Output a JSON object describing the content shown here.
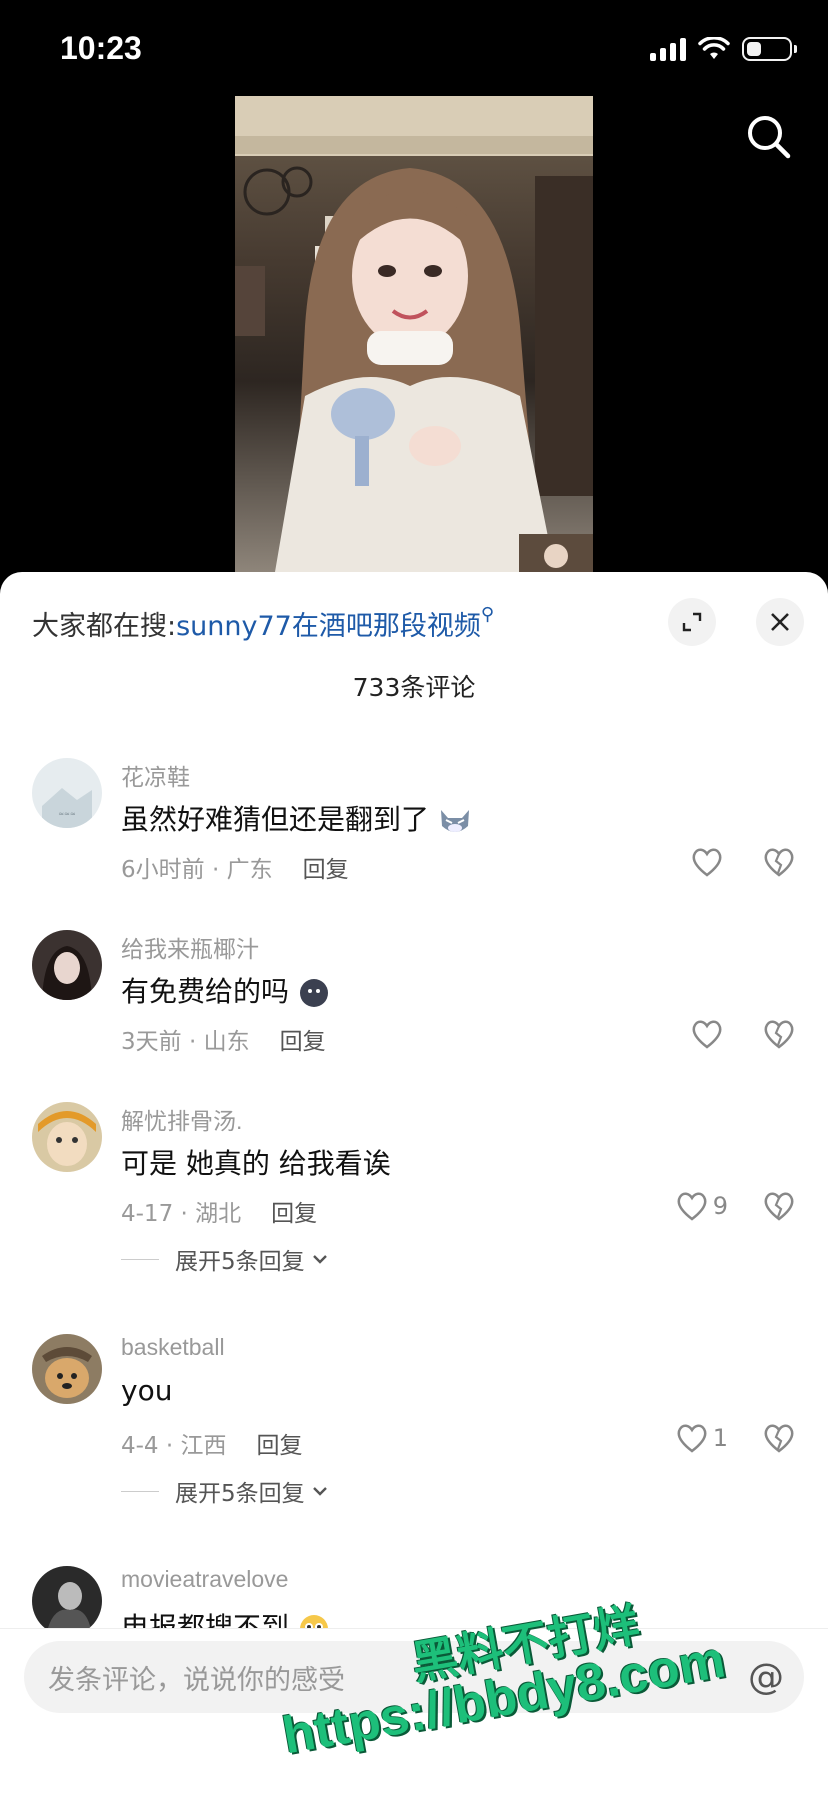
{
  "status_bar": {
    "time": "10:23"
  },
  "header": {
    "trend_prefix": "大家都在搜:",
    "trend_query": "sunny77在酒吧那段视频",
    "comment_count": "733条评论"
  },
  "comments": [
    {
      "name": "花凉鞋",
      "text": "虽然好难猜但还是翻到了",
      "emoji": "wolf-emoji",
      "meta": "6小时前 · 广东",
      "reply": "回复",
      "likes": ""
    },
    {
      "name": "给我来瓶椰汁",
      "text": "有免费给的吗",
      "emoji": "ball-emoji",
      "meta": "3天前 · 山东",
      "reply": "回复",
      "likes": ""
    },
    {
      "name": "解忧排骨汤.",
      "text": "可是 她真的 给我看诶",
      "meta": "4-17 · 湖北",
      "reply": "回复",
      "likes": "9",
      "expand": "展开5条回复"
    },
    {
      "name": "basketball",
      "text": "you",
      "meta": "4-4 · 江西",
      "reply": "回复",
      "likes": "1",
      "expand": "展开5条回复"
    },
    {
      "name": "movieatravelove",
      "text": "电报都搜不到",
      "emoji": "flushed-emoji"
    }
  ],
  "input": {
    "placeholder": "发条评论，说说你的感受",
    "at_symbol": "@"
  },
  "watermark": {
    "line1": "黑料不打烊",
    "line2": "https://bbdy8.com"
  }
}
